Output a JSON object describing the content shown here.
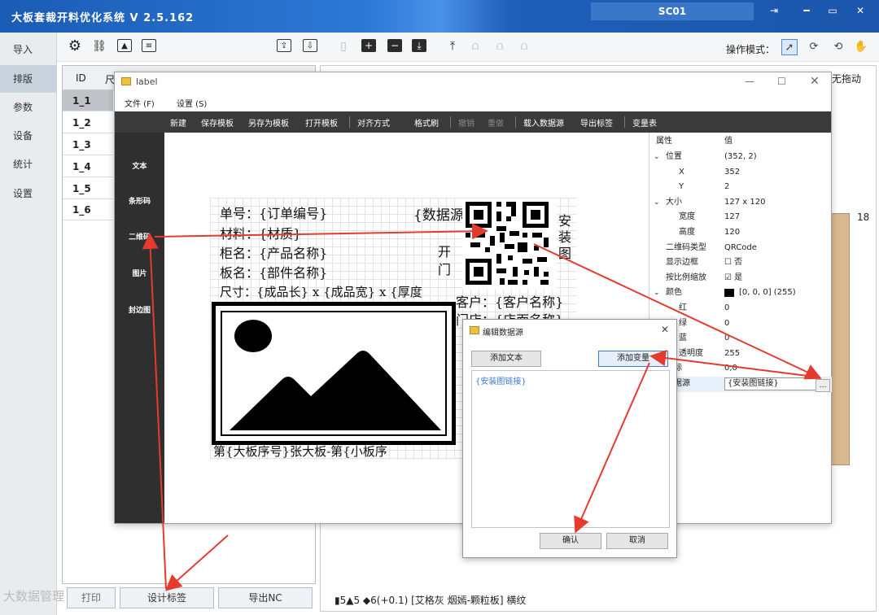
{
  "app": {
    "title": "大板套裁开料优化系统  V 2.5.162",
    "user": "SC01"
  },
  "nav": {
    "items": [
      "导入",
      "排版",
      "参数",
      "设备",
      "统计",
      "设置"
    ]
  },
  "toolbar": {
    "opmode_label": "操作模式："
  },
  "table": {
    "header_id": "ID",
    "header_col2": "尺",
    "rows": [
      "1_1",
      "1_2",
      "1_3",
      "1_4",
      "1_5",
      "1_6"
    ]
  },
  "bottom": {
    "design_label": "设计标签",
    "export_nc": "导出NC",
    "partial_btn": "打印"
  },
  "right": {
    "nodrag": "无拖动",
    "num": "18",
    "status": "▮5▲5  ◆6(+0.1)   [艾格灰 烟嫣-颗粒板]  横纹"
  },
  "label_window": {
    "title": "label",
    "menu": [
      "文件 (F)",
      "设置 (S)"
    ],
    "tools": [
      "新建",
      "保存模板",
      "另存为模板",
      "打开模板",
      "对齐方式",
      "格式刷",
      "撤销",
      "重做",
      "载入数据源",
      "导出标签",
      "变量表"
    ],
    "side": [
      "文本",
      "条形码",
      "二维码",
      "图片",
      "封边图"
    ],
    "canvas": {
      "line1": "单号：{订单编号}",
      "line2": "材料：{材质}",
      "line3": "柜名：{产品名称}",
      "line4": "板名：{部件名称}",
      "line5": "尺寸：{成品长} x {成品宽} x {厚度",
      "datasource": "{数据源",
      "open": "开",
      "door": "门",
      "install": [
        "安",
        "装",
        "图"
      ],
      "customer": "客户：{客户名称}",
      "store": "门店：{店面名称}",
      "footer": "第{大板序号}张大板-第{小板序"
    },
    "props": {
      "header_k": "属性",
      "header_v": "值",
      "rows": [
        {
          "k": "位置",
          "v": "(352, 2)",
          "level": 0,
          "expand": true
        },
        {
          "k": "X",
          "v": "352",
          "level": 1
        },
        {
          "k": "Y",
          "v": "2",
          "level": 1
        },
        {
          "k": "大小",
          "v": "127 x 120",
          "level": 0,
          "expand": true
        },
        {
          "k": "宽度",
          "v": "127",
          "level": 1
        },
        {
          "k": "高度",
          "v": "120",
          "level": 1
        },
        {
          "k": "二维码类型",
          "v": "QRCode",
          "level": 0
        },
        {
          "k": "显示边框",
          "v": "☐ 否",
          "level": 0
        },
        {
          "k": "按比例缩放",
          "v": "☑ 是",
          "level": 0
        },
        {
          "k": "颜色",
          "v": "[0, 0, 0] (255)",
          "level": 0,
          "expand": true
        },
        {
          "k": "红",
          "v": "0",
          "level": 1
        },
        {
          "k": "绿",
          "v": "0",
          "level": 1
        },
        {
          "k": "蓝",
          "v": "0",
          "level": 1
        },
        {
          "k": "透明度",
          "v": "255",
          "level": 1
        },
        {
          "k": "坐标",
          "v": "0,0",
          "level": 0
        },
        {
          "k": "数据源",
          "v": "{安装图链接}",
          "level": 0
        }
      ]
    }
  },
  "dialog": {
    "title": "编辑数据源",
    "add_text": "添加文本",
    "add_var": "添加变量",
    "content": "{安装图链接}",
    "ok": "确认",
    "cancel": "取消"
  },
  "watermark": "大数据管理",
  "colors": {
    "titlebar": "#1f5fb8",
    "arrow": "#e53b2c",
    "dark_toolbar": "#3a3a3a"
  }
}
